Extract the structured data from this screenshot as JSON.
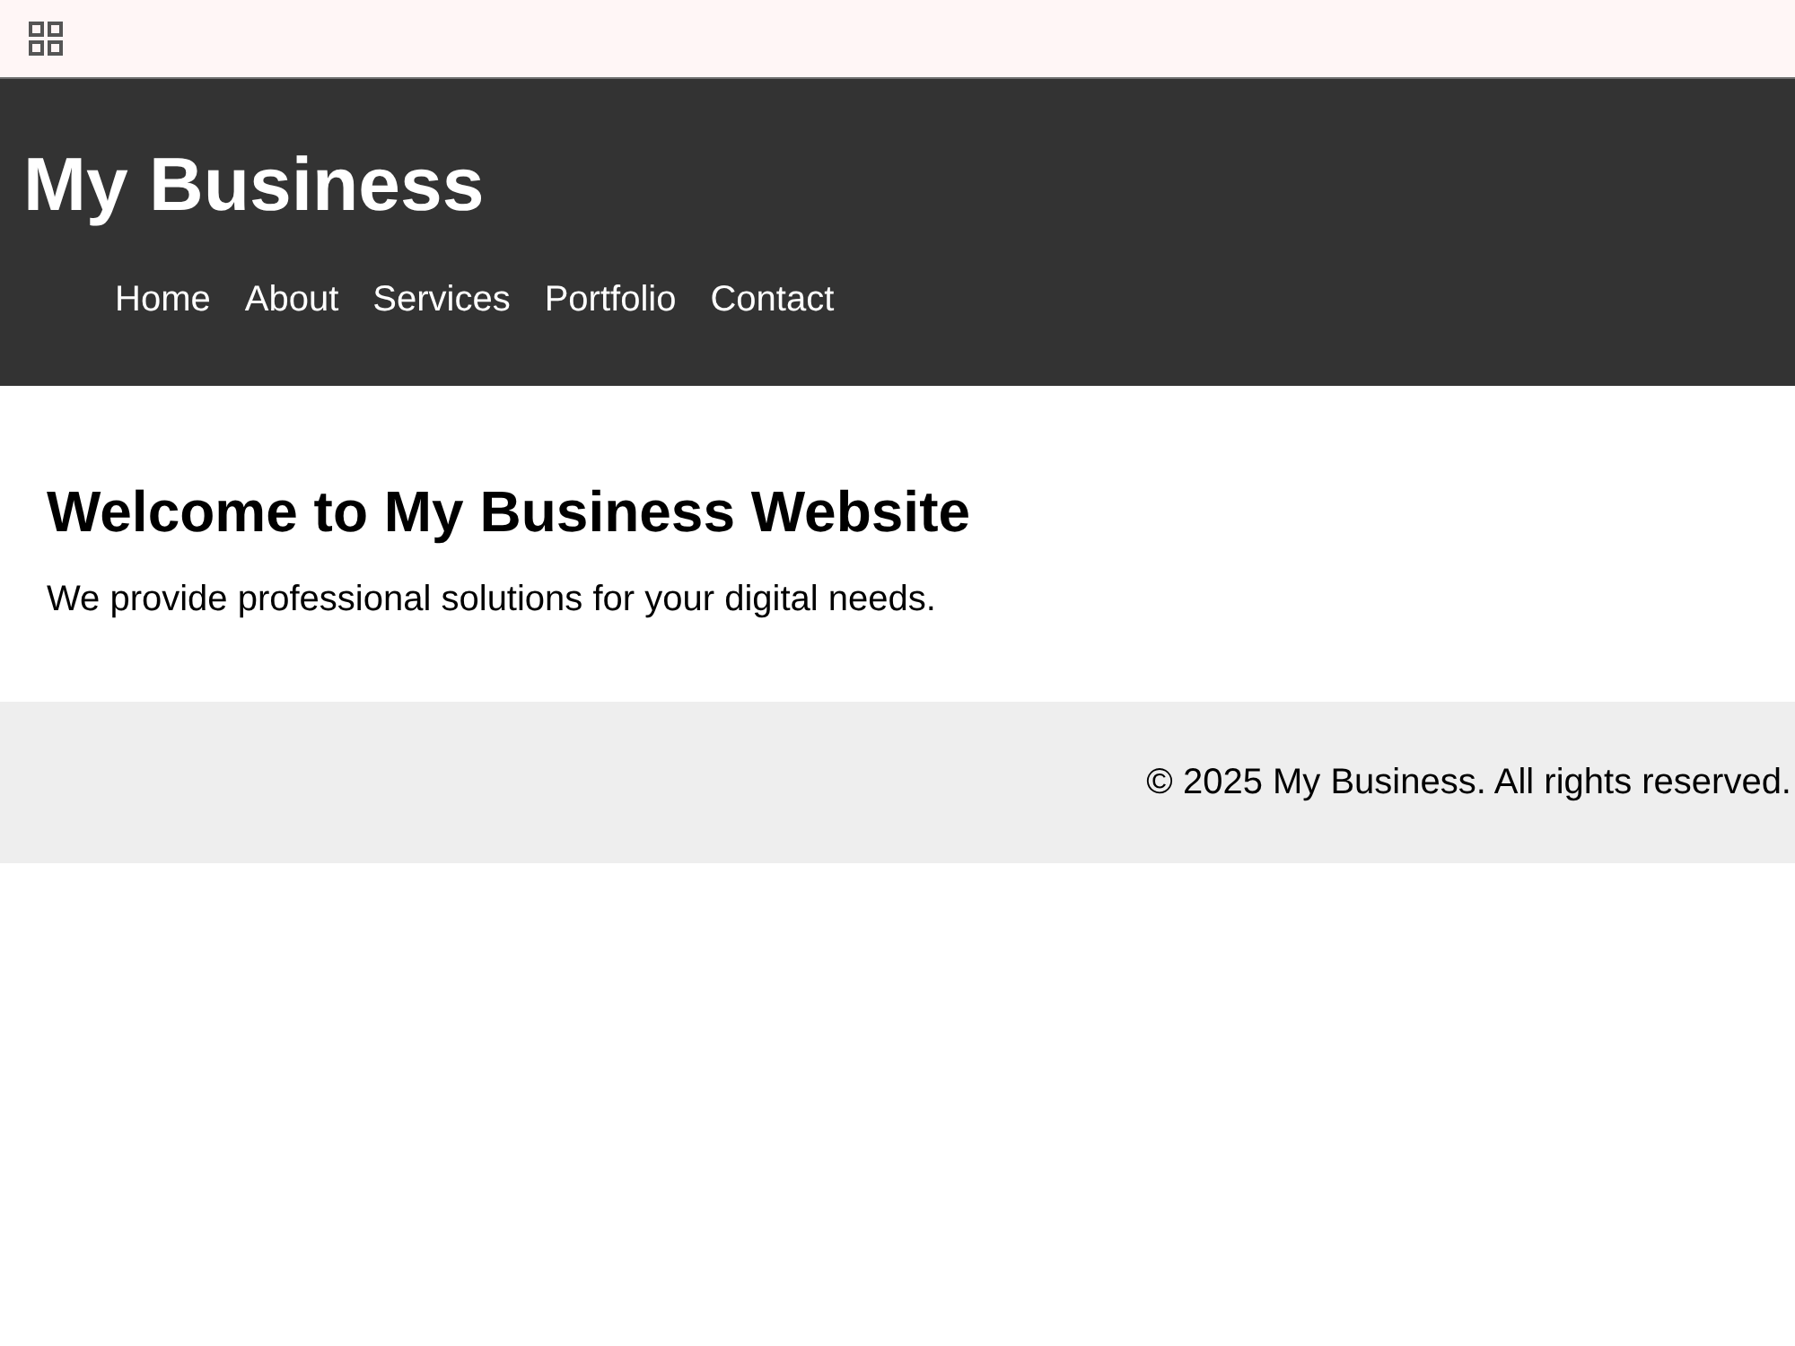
{
  "header": {
    "title": "My Business",
    "nav": [
      {
        "label": "Home"
      },
      {
        "label": "About"
      },
      {
        "label": "Services"
      },
      {
        "label": "Portfolio"
      },
      {
        "label": "Contact"
      }
    ]
  },
  "main": {
    "heading": "Welcome to My Business Website",
    "text": "We provide professional solutions for your digital needs."
  },
  "footer": {
    "text": "© 2025 My Business. All rights reserved."
  }
}
